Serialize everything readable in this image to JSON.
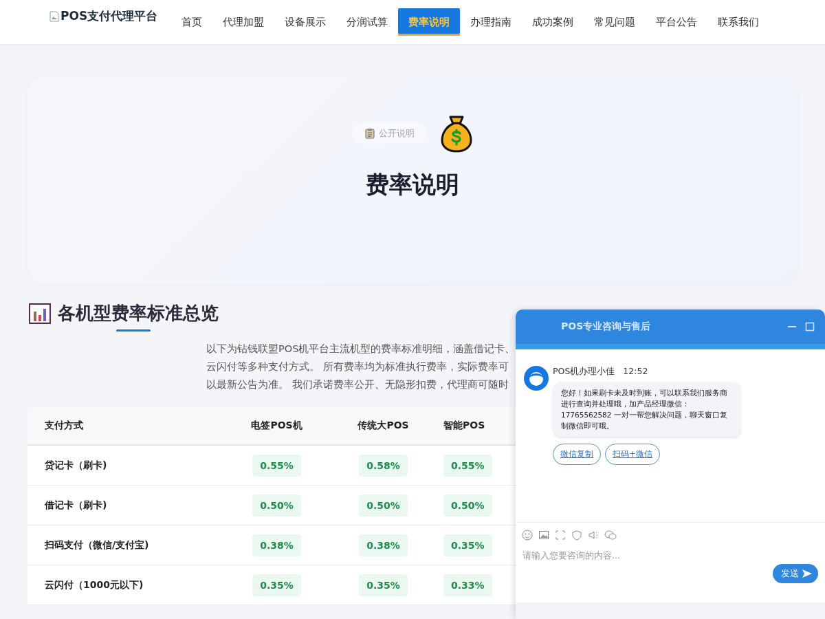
{
  "nav": {
    "logo": "POS支付代理平台",
    "items": [
      {
        "label": "首页",
        "selected": false
      },
      {
        "label": "代理加盟",
        "selected": false
      },
      {
        "label": "设备展示",
        "selected": false
      },
      {
        "label": "分润试算",
        "selected": false
      },
      {
        "label": "费率说明",
        "selected": true
      },
      {
        "label": "办理指南",
        "selected": false
      },
      {
        "label": "成功案例",
        "selected": false
      },
      {
        "label": "常见问题",
        "selected": false
      },
      {
        "label": "平台公告",
        "selected": false
      },
      {
        "label": "联系我们",
        "selected": false
      }
    ]
  },
  "hero": {
    "badge": "公开说明",
    "title": "费率说明"
  },
  "section": {
    "title": "各机型费率标准总览",
    "lines": [
      "以下为钻钱联盟POS机平台主流机型的费率标准明细，涵盖借记卡、",
      "云闪付等多种支付方式。 所有费率均为标准执行费率，实际费率可",
      "以最新公告为准。 我们承诺费率公开、无隐形扣费，代理商可随时"
    ]
  },
  "table": {
    "columns": [
      "支付方式",
      "电签POS机",
      "传统大POS",
      "智能POS"
    ],
    "rows": [
      {
        "cells": [
          "贷记卡（刷卡)",
          "0.55%",
          "0.58%",
          "0.55%"
        ]
      },
      {
        "cells": [
          "借记卡（刷卡)",
          "0.50%",
          "0.50%",
          "0.50%"
        ]
      },
      {
        "cells": [
          "扫码支付（微信/支付宝)",
          "0.38%",
          "0.38%",
          "0.35%"
        ]
      },
      {
        "cells": [
          "云闪付（1000元以下)",
          "0.35%",
          "0.35%",
          "0.33%"
        ]
      }
    ]
  },
  "chat": {
    "title": "POS专业咨询与售后",
    "messages": [
      {
        "sender": "POS机办理小佳",
        "time": "12:52",
        "text": "您好！如果刷卡未及时到账，可以联系我们服务商进行查询并处理哦，加产品经理微信：17765562582 一对一帮您解决问题，聊天窗口复制微信即可哦。",
        "actions": [
          "微信复制",
          "扫码+微信"
        ]
      }
    ],
    "placeholder": "请输入您要咨询的内容...",
    "send": "发送"
  }
}
